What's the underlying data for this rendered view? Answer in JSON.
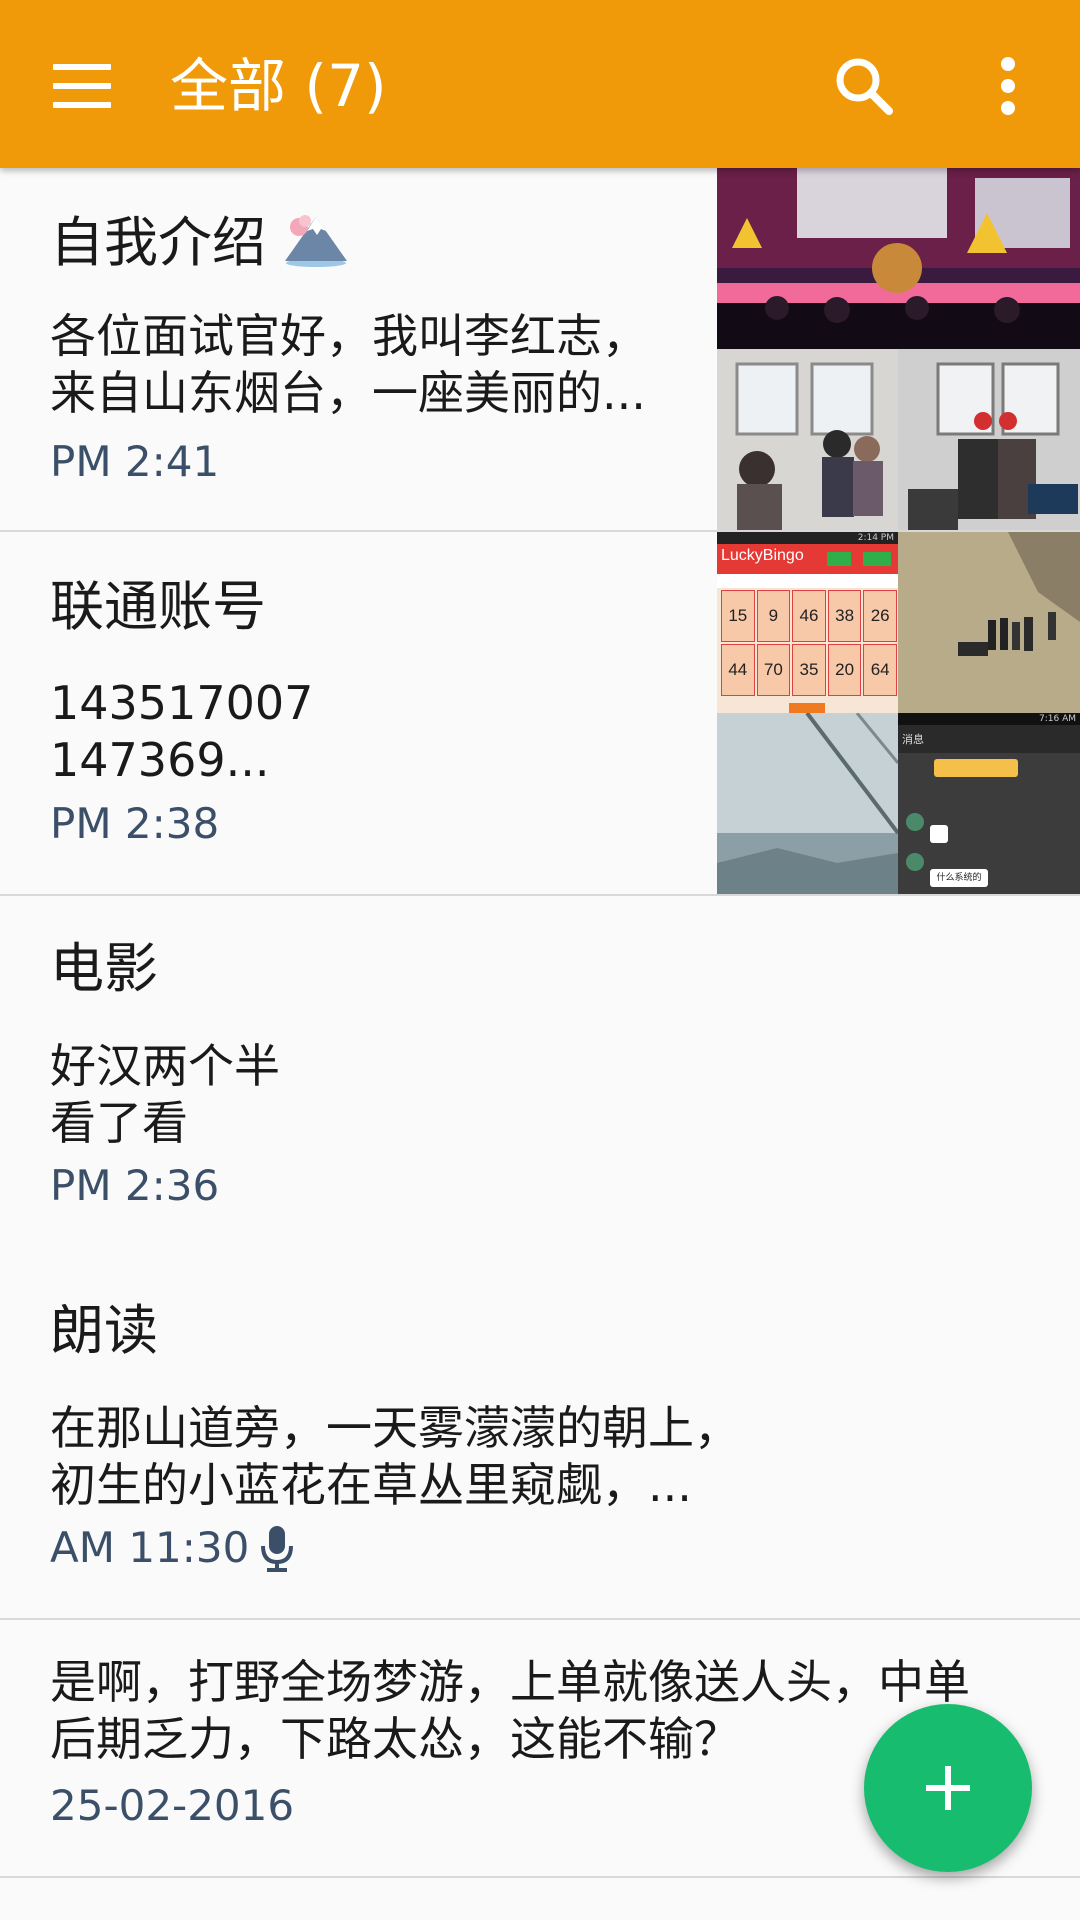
{
  "header": {
    "title": "全部 (7)",
    "bar_color": "#f09a0a",
    "menu_icon": "hamburger-menu-icon",
    "search_icon": "search-icon",
    "more_icon": "more-vertical-icon"
  },
  "notes": [
    {
      "title": "自我介绍",
      "title_icon": "mountain-emoji-icon",
      "body": "各位面试官好，我叫李红志，\n来自山东烟台，一座美丽的...",
      "time": "PM 2:41"
    },
    {
      "title": "联通账号",
      "body": "143517007\n147369...",
      "time": "PM 2:38",
      "bingo": {
        "app_name": "LuckyBingo",
        "status_time": "2:14 PM",
        "row1": [
          "15",
          "9",
          "46",
          "38",
          "26"
        ],
        "row2": [
          "44",
          "70",
          "35",
          "20",
          "64"
        ]
      },
      "chat": {
        "status_time": "7:16 AM",
        "back_label": "消息",
        "message": "什么系统的"
      }
    },
    {
      "title": "电影",
      "body": "好汉两个半\n看了看",
      "time": "PM 2:36"
    },
    {
      "title": "朗读",
      "body": "在那山道旁，一天雾濛濛的朝上，\n初生的小蓝花在草丛里窥觑，...",
      "time": "AM 11:30",
      "time_icon": "microphone-icon"
    },
    {
      "title": "",
      "body": "是啊，打野全场梦游，上单就像送人头，中单\n后期乏力，下路太怂，这能不输？",
      "time": "25-02-2016"
    }
  ],
  "fab": {
    "icon": "plus-icon",
    "color": "#18bc6e"
  }
}
